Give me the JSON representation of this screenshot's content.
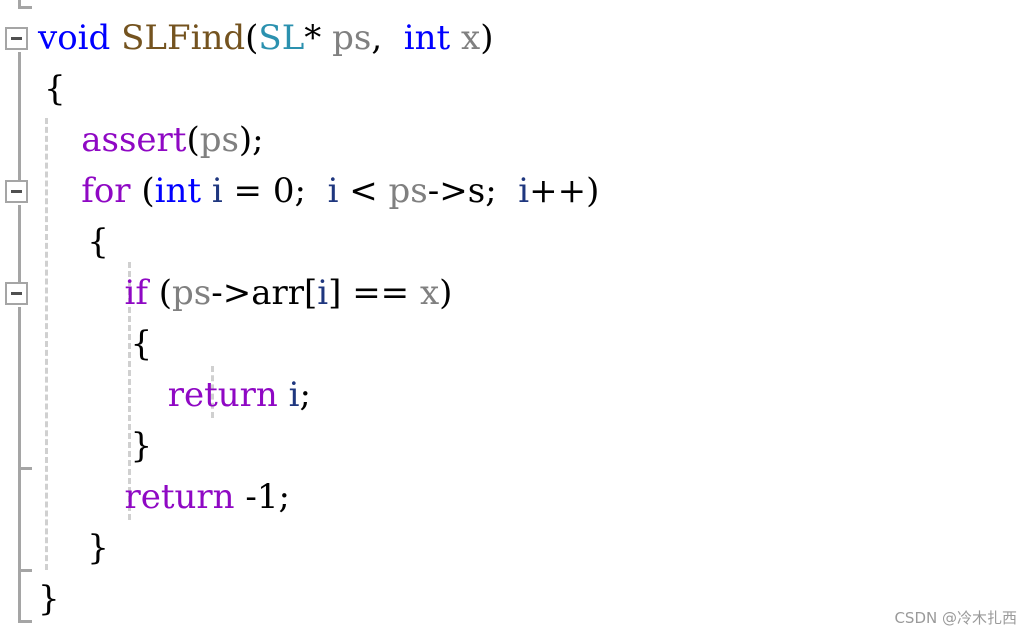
{
  "code": {
    "language": "C",
    "lines": [
      {
        "tokens": [
          {
            "t": "void",
            "c": "kw"
          },
          {
            "t": " ",
            "c": "br"
          },
          {
            "t": "SLFind",
            "c": "fn"
          },
          {
            "t": "(",
            "c": "br"
          },
          {
            "t": "SL",
            "c": "type"
          },
          {
            "t": "* ",
            "c": "br"
          },
          {
            "t": "ps",
            "c": "param"
          },
          {
            "t": ",  ",
            "c": "br"
          },
          {
            "t": "int",
            "c": "kw"
          },
          {
            "t": " ",
            "c": "br"
          },
          {
            "t": "x",
            "c": "param"
          },
          {
            "t": ")",
            "c": "br"
          }
        ]
      },
      {
        "tokens": [
          {
            "t": "{",
            "c": "br"
          }
        ]
      },
      {
        "tokens": [
          {
            "t": "    assert",
            "c": "ctl"
          },
          {
            "t": "(",
            "c": "br"
          },
          {
            "t": "ps",
            "c": "param"
          },
          {
            "t": ");",
            "c": "br"
          }
        ]
      },
      {
        "tokens": [
          {
            "t": "    for",
            "c": "ctl"
          },
          {
            "t": " (",
            "c": "br"
          },
          {
            "t": "int",
            "c": "kw"
          },
          {
            "t": " ",
            "c": "br"
          },
          {
            "t": "i",
            "c": "local"
          },
          {
            "t": " = 0;  ",
            "c": "br"
          },
          {
            "t": "i",
            "c": "local"
          },
          {
            "t": " < ",
            "c": "br"
          },
          {
            "t": "ps",
            "c": "param"
          },
          {
            "t": "->s;  ",
            "c": "br"
          },
          {
            "t": "i",
            "c": "local"
          },
          {
            "t": "++)",
            "c": "br"
          }
        ]
      },
      {
        "tokens": [
          {
            "t": "    {",
            "c": "br"
          }
        ]
      },
      {
        "tokens": [
          {
            "t": "        if",
            "c": "ctl"
          },
          {
            "t": " (",
            "c": "br"
          },
          {
            "t": "ps",
            "c": "param"
          },
          {
            "t": "->arr[",
            "c": "br"
          },
          {
            "t": "i",
            "c": "local"
          },
          {
            "t": "] == ",
            "c": "br"
          },
          {
            "t": "x",
            "c": "param"
          },
          {
            "t": ")",
            "c": "br"
          }
        ]
      },
      {
        "tokens": [
          {
            "t": "        {",
            "c": "br"
          }
        ]
      },
      {
        "tokens": [
          {
            "t": "            return",
            "c": "ctl"
          },
          {
            "t": " ",
            "c": "br"
          },
          {
            "t": "i",
            "c": "local"
          },
          {
            "t": ";",
            "c": "br"
          }
        ]
      },
      {
        "tokens": [
          {
            "t": "        }",
            "c": "br"
          }
        ]
      },
      {
        "tokens": [
          {
            "t": "        return",
            "c": "ctl"
          },
          {
            "t": " -1;",
            "c": "br"
          }
        ]
      },
      {
        "tokens": [
          {
            "t": "    }",
            "c": "br"
          }
        ]
      },
      {
        "tokens": [
          {
            "t": "}",
            "c": "br"
          }
        ]
      }
    ]
  },
  "colors": {
    "keyword": "#0000ff",
    "control": "#8f08c4",
    "function": "#74531f",
    "type": "#2b91af",
    "parameter": "#808080",
    "local": "#1f377f",
    "fold_gutter": "#a5a5a5",
    "indent_guide": "#d0d0d0"
  },
  "watermark": "CSDN @冷木扎西"
}
